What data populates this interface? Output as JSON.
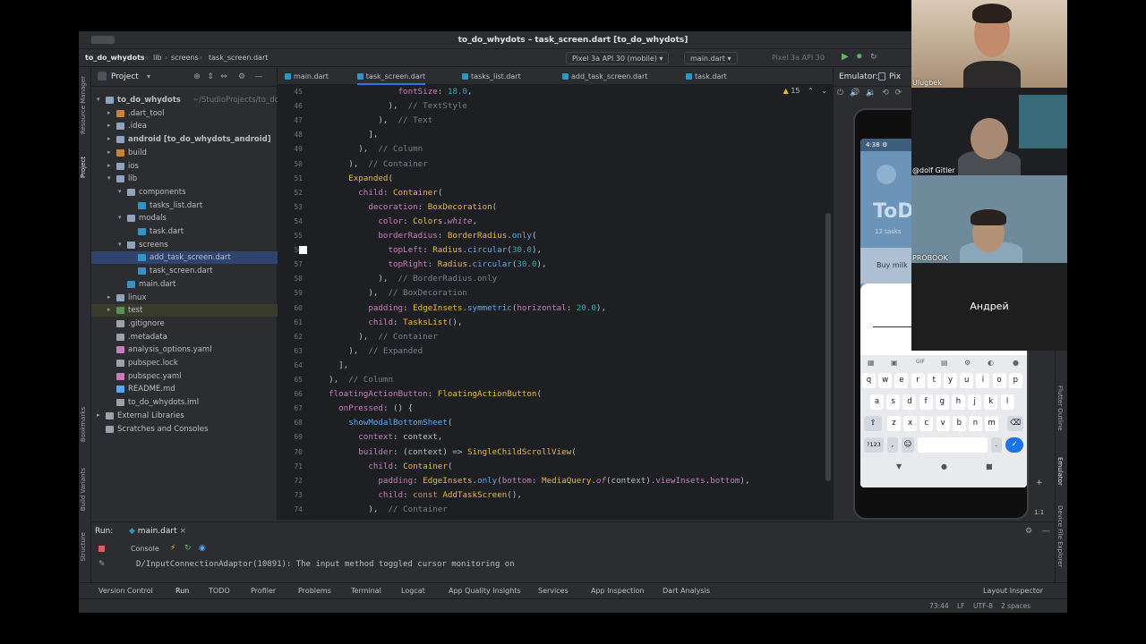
{
  "window": {
    "title": "to_do_whydots – task_screen.dart [to_do_whydots]"
  },
  "navbar": {
    "crumbs": [
      "to_do_whydots",
      "lib",
      "screens",
      "task_screen.dart"
    ],
    "device": "Pixel 3a API 30 (mobile)",
    "run_config": "main.dart",
    "pixel_label": "Pixel 3a API 30"
  },
  "left_stripe": [
    "Resource Manager",
    "Project",
    "Bookmarks",
    "Build Variants",
    "Structure"
  ],
  "project": {
    "header": "Project",
    "tree": [
      {
        "label": "to_do_whydots",
        "suffix": " ~/StudioProjects/to_do_w",
        "depth": 0,
        "arrow": "▾",
        "kind": "folder",
        "bold": true
      },
      {
        "label": ".dart_tool",
        "depth": 1,
        "arrow": "▸",
        "kind": "folder-orange"
      },
      {
        "label": ".idea",
        "depth": 1,
        "arrow": "▸",
        "kind": "folder"
      },
      {
        "label": "android [to_do_whydots_android]",
        "depth": 1,
        "arrow": "▸",
        "kind": "folder",
        "bold": true
      },
      {
        "label": "build",
        "depth": 1,
        "arrow": "▸",
        "kind": "folder-orange"
      },
      {
        "label": "ios",
        "depth": 1,
        "arrow": "▸",
        "kind": "folder"
      },
      {
        "label": "lib",
        "depth": 1,
        "arrow": "▾",
        "kind": "folder"
      },
      {
        "label": "components",
        "depth": 2,
        "arrow": "▾",
        "kind": "folder"
      },
      {
        "label": "tasks_list.dart",
        "depth": 3,
        "arrow": "",
        "kind": "dart"
      },
      {
        "label": "modals",
        "depth": 2,
        "arrow": "▾",
        "kind": "folder"
      },
      {
        "label": "task.dart",
        "depth": 3,
        "arrow": "",
        "kind": "dart"
      },
      {
        "label": "screens",
        "depth": 2,
        "arrow": "▾",
        "kind": "folder"
      },
      {
        "label": "add_task_screen.dart",
        "depth": 3,
        "arrow": "",
        "kind": "dart",
        "selected": true
      },
      {
        "label": "task_screen.dart",
        "depth": 3,
        "arrow": "",
        "kind": "dart"
      },
      {
        "label": "main.dart",
        "depth": 2,
        "arrow": "",
        "kind": "dart"
      },
      {
        "label": "linux",
        "depth": 1,
        "arrow": "▸",
        "kind": "folder"
      },
      {
        "label": "test",
        "depth": 1,
        "arrow": "▸",
        "kind": "folder-green",
        "highlight": true
      },
      {
        "label": ".gitignore",
        "depth": 1,
        "arrow": "",
        "kind": "file"
      },
      {
        "label": ".metadata",
        "depth": 1,
        "arrow": "",
        "kind": "file"
      },
      {
        "label": "analysis_options.yaml",
        "depth": 1,
        "arrow": "",
        "kind": "yaml"
      },
      {
        "label": "pubspec.lock",
        "depth": 1,
        "arrow": "",
        "kind": "file"
      },
      {
        "label": "pubspec.yaml",
        "depth": 1,
        "arrow": "",
        "kind": "yaml"
      },
      {
        "label": "README.md",
        "depth": 1,
        "arrow": "",
        "kind": "md"
      },
      {
        "label": "to_do_whydots.iml",
        "depth": 1,
        "arrow": "",
        "kind": "file"
      },
      {
        "label": "External Libraries",
        "depth": 0,
        "arrow": "▸",
        "kind": "lib"
      },
      {
        "label": "Scratches and Consoles",
        "depth": 0,
        "arrow": "",
        "kind": "scratch"
      }
    ]
  },
  "editor": {
    "tabs": [
      "main.dart",
      "task_screen.dart",
      "tasks_list.dart",
      "add_task_screen.dart",
      "task.dart"
    ],
    "active_tab": 1,
    "inspection_count": "15",
    "lines": [
      {
        "n": "45",
        "html": "                <span class='tk-prop'>fontSize</span>: <span class='tk-num'>18.0</span>,"
      },
      {
        "n": "46",
        "html": "              ),  <span class='tk-cm'>// TextStyle</span>"
      },
      {
        "n": "47",
        "html": "            ),  <span class='tk-cm'>// Text</span>"
      },
      {
        "n": "48",
        "html": "          ],"
      },
      {
        "n": "49",
        "html": "        ),  <span class='tk-cm'>// Column</span>"
      },
      {
        "n": "50",
        "html": "      ),  <span class='tk-cm'>// Container</span>"
      },
      {
        "n": "51",
        "html": "      <span class='tk-cls'>Expanded</span>("
      },
      {
        "n": "52",
        "html": "        <span class='tk-prop'>child</span>: <span class='tk-cls'>Container</span>("
      },
      {
        "n": "53",
        "html": "          <span class='tk-prop'>decoration</span>: <span class='tk-cls'>BoxDecoration</span>("
      },
      {
        "n": "54",
        "html": "            <span class='tk-prop'>color</span>: <span class='tk-cls'>Colors</span>.<span class='tk-it'>white</span>,"
      },
      {
        "n": "55",
        "html": "            <span class='tk-prop'>borderRadius</span>: <span class='tk-cls'>BorderRadius</span>.<span class='tk-fn'>only</span>("
      },
      {
        "n": "56",
        "html": "              <span class='tk-prop'>topLeft</span>: <span class='tk-cls'>Radius</span>.<span class='tk-fn'>circular</span>(<span class='tk-num'>30.0</span>),"
      },
      {
        "n": "57",
        "html": "              <span class='tk-prop'>topRight</span>: <span class='tk-cls'>Radius</span>.<span class='tk-fn'>circular</span>(<span class='tk-num'>30.0</span>),"
      },
      {
        "n": "58",
        "html": "            ),  <span class='tk-cm'>// BorderRadius.only</span>"
      },
      {
        "n": "59",
        "html": "          ),  <span class='tk-cm'>// BoxDecoration</span>"
      },
      {
        "n": "60",
        "html": "          <span class='tk-prop'>padding</span>: <span class='tk-cls'>EdgeInsets</span>.<span class='tk-fn'>symmetric</span>(<span class='tk-prop'>horizontal</span>: <span class='tk-num'>20.0</span>),"
      },
      {
        "n": "61",
        "html": "          <span class='tk-prop'>child</span>: <span class='tk-cls'>TasksList</span>(),"
      },
      {
        "n": "62",
        "html": "        ),  <span class='tk-cm'>// Container</span>"
      },
      {
        "n": "63",
        "html": "      ),  <span class='tk-cm'>// Expanded</span>"
      },
      {
        "n": "64",
        "html": "    ],"
      },
      {
        "n": "65",
        "html": "  ),  <span class='tk-cm'>// Column</span>"
      },
      {
        "n": "66",
        "html": "  <span class='tk-prop'>floatingActionButton</span>: <span class='tk-cls'>FloatingActionButton</span>("
      },
      {
        "n": "67",
        "html": "    <span class='tk-prop'>onPressed</span>: () {"
      },
      {
        "n": "68",
        "html": "      <span class='tk-fn'>showModalBottomSheet</span>("
      },
      {
        "n": "69",
        "html": "        <span class='tk-prop'>context</span>: context,"
      },
      {
        "n": "70",
        "html": "        <span class='tk-prop'>builder</span>: (context) => <span class='tk-cls'>SingleChildScrollView</span>("
      },
      {
        "n": "71",
        "html": "          <span class='tk-prop'>child</span>: <span class='tk-cls'>Container</span>("
      },
      {
        "n": "72",
        "html": "            <span class='tk-prop'>padding</span>: <span class='tk-cls'>EdgeInsets</span>.<span class='tk-fn'>only</span>(<span class='tk-prop'>bottom</span>: <span class='tk-cls'>MediaQuery</span>.<span class='tk-it'>of</span>(context).<span class='tk-prop'>viewInsets</span>.<span class='tk-prop'>bottom</span>),"
      },
      {
        "n": "73",
        "html": "            <span class='tk-prop'>child</span>: <span class='tk-kw'>const</span> <span class='tk-cls'>AddTaskScreen</span>(),"
      },
      {
        "n": "74",
        "html": "          ),  <span class='tk-cm'>// Container</span>"
      }
    ]
  },
  "emulator": {
    "header": "Emulator:",
    "device_short": "Pix",
    "phone": {
      "time": "4:38",
      "app_title": "ToDo",
      "task_count": "12 tasks",
      "first_task": "Buy milk"
    },
    "keyboard": {
      "row1": [
        "q",
        "w",
        "e",
        "r",
        "t",
        "y",
        "u",
        "i",
        "o",
        "p"
      ],
      "row2": [
        "a",
        "s",
        "d",
        "f",
        "g",
        "h",
        "j",
        "k",
        "l"
      ],
      "row3": [
        "z",
        "x",
        "c",
        "v",
        "b",
        "n",
        "m"
      ],
      "symbols_key": "?123",
      "comma_key": ",",
      "period_key": "."
    },
    "zoom_label": "1:1"
  },
  "right_stripe": [
    "Flutter Outline",
    "Emulator",
    "Device File Explorer"
  ],
  "run": {
    "label": "Run:",
    "tab": "main.dart",
    "console": "Console",
    "output": "D/InputConnectionAdaptor(10891): The input method toggled cursor monitoring on"
  },
  "bottom_tools": [
    "Version Control",
    "Run",
    "TODO",
    "Profiler",
    "Problems",
    "Terminal",
    "Logcat",
    "App Quality Insights",
    "Services",
    "App Inspection",
    "Dart Analysis",
    "Layout Inspector"
  ],
  "status": {
    "position": "73:44",
    "line_sep": "LF",
    "encoding": "UTF-8",
    "indent": "2 spaces"
  },
  "participants": [
    {
      "name": "Ulugbek"
    },
    {
      "name": "@dolf Gitler"
    },
    {
      "name": "PROBOOK"
    },
    {
      "name": "Андрей"
    }
  ]
}
